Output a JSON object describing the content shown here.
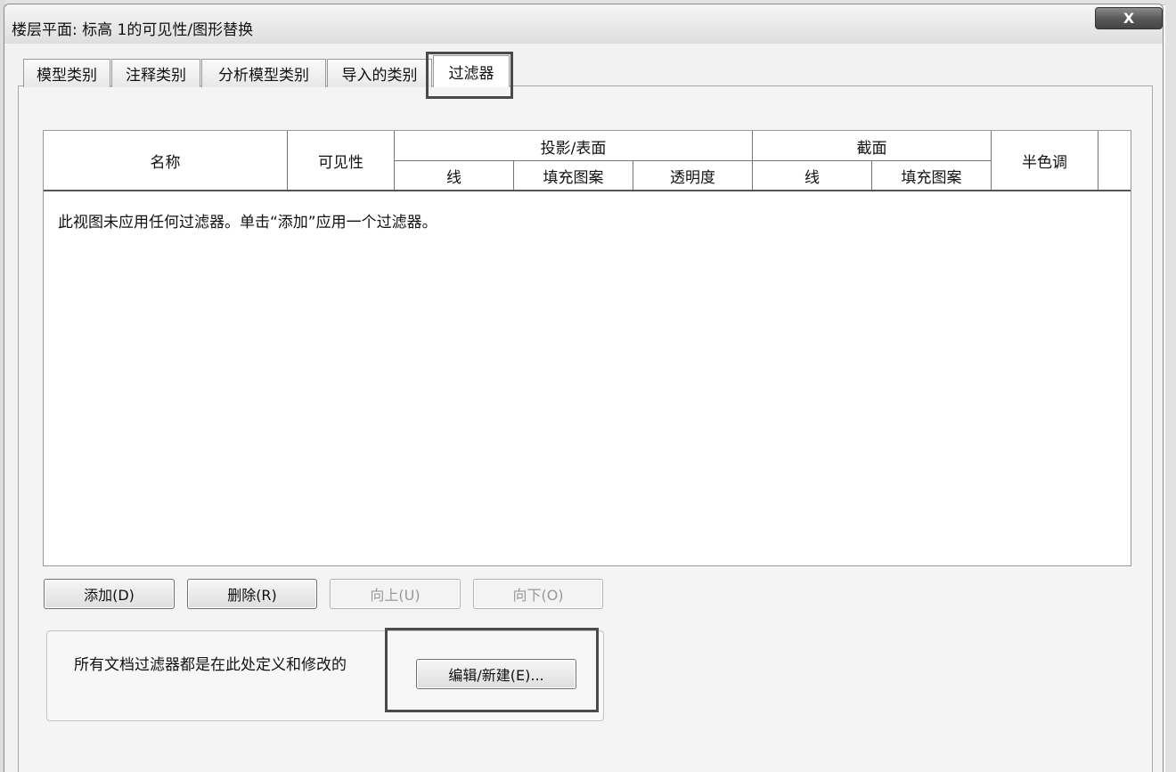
{
  "window": {
    "title": "楼层平面: 标高 1的可见性/图形替换",
    "close_label": "X"
  },
  "tabs": [
    {
      "label": "模型类别"
    },
    {
      "label": "注释类别"
    },
    {
      "label": "分析模型类别"
    },
    {
      "label": "导入的类别"
    },
    {
      "label": "过滤器",
      "active": true
    }
  ],
  "table": {
    "headers": {
      "name": "名称",
      "visibility": "可见性",
      "projection_surface": "投影/表面",
      "proj_line": "线",
      "proj_fill": "填充图案",
      "proj_transparency": "透明度",
      "cut": "截面",
      "cut_line": "线",
      "cut_fill": "填充图案",
      "halftone": "半色调"
    },
    "empty_message": "此视图未应用任何过滤器。单击“添加”应用一个过滤器。"
  },
  "buttons": {
    "add": "添加(D)",
    "delete": "删除(R)",
    "up": "向上(U)",
    "down": "向下(O)"
  },
  "filter_group": {
    "description": "所有文档过滤器都是在此处定义和修改的",
    "edit_button": "编辑/新建(E)..."
  }
}
